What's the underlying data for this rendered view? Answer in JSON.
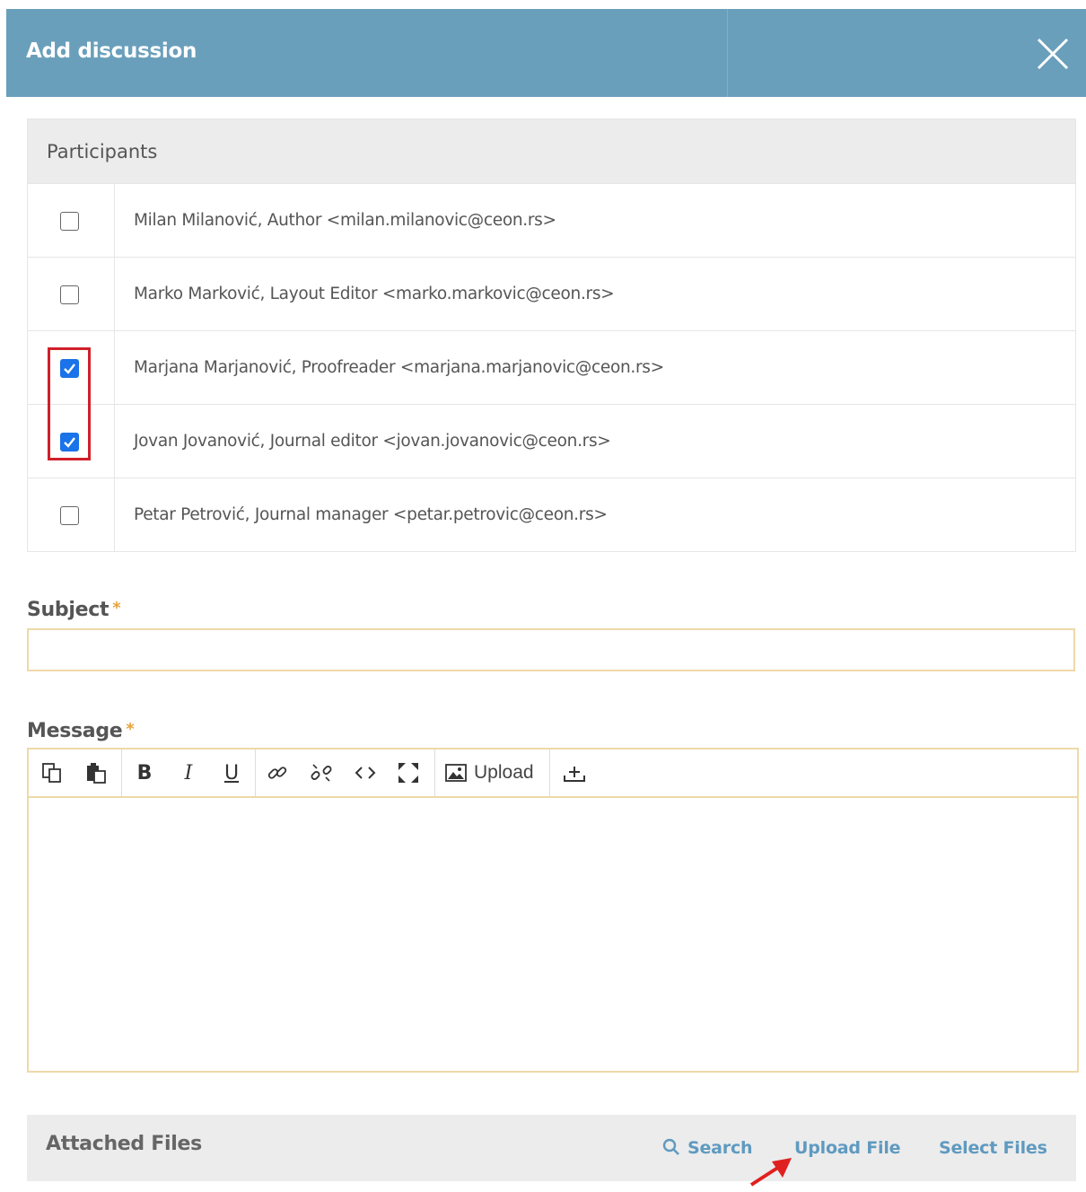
{
  "dialog": {
    "title": "Add discussion",
    "close_icon": "close-icon"
  },
  "participants": {
    "heading": "Participants",
    "items": [
      {
        "label": "Milan Milanović, Author <milan.milanovic@ceon.rs>",
        "checked": false
      },
      {
        "label": "Marko Marković, Layout Editor <marko.markovic@ceon.rs>",
        "checked": false
      },
      {
        "label": "Marjana Marjanović, Proofreader <marjana.marjanovic@ceon.rs>",
        "checked": true
      },
      {
        "label": "Jovan Jovanović, Journal editor <jovan.jovanovic@ceon.rs>",
        "checked": true
      },
      {
        "label": "Petar Petrović, Journal manager <petar.petrovic@ceon.rs>",
        "checked": false
      }
    ]
  },
  "subject": {
    "label": "Subject",
    "required_mark": "*",
    "value": ""
  },
  "message": {
    "label": "Message",
    "required_mark": "*",
    "toolbar": {
      "buttons": [
        "copy-icon",
        "paste-icon",
        "bold-icon",
        "italic-icon",
        "underline-icon",
        "link-icon",
        "unlink-icon",
        "code-icon",
        "fullscreen-icon",
        "image-icon",
        "insert-icon"
      ],
      "bold_glyph": "B",
      "italic_glyph": "I",
      "underline_glyph": "U",
      "upload_label": "Upload"
    },
    "value": ""
  },
  "attached_files": {
    "heading": "Attached Files",
    "search_label": "Search",
    "upload_label": "Upload File",
    "select_label": "Select Files"
  },
  "colors": {
    "header": "#6a9fbb",
    "link": "#5f9ac0",
    "checkbox_checked": "#1a73e8",
    "highlight": "#d0202a",
    "field_border": "#eed9a8"
  }
}
